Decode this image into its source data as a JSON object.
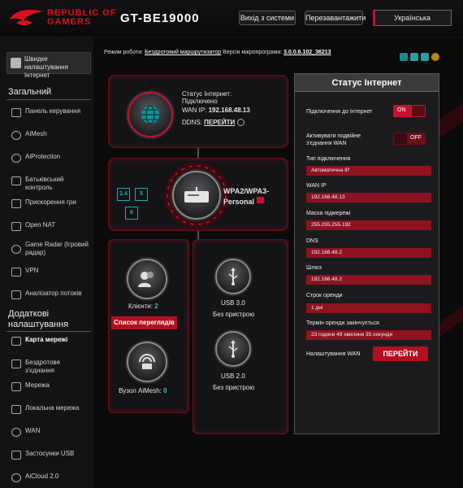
{
  "header": {
    "brand_line1": "REPUBLIC OF",
    "brand_line2": "GAMERS",
    "model": "GT-BE19000",
    "logout_label": "Вихід з системи",
    "reboot_label": "Перезавантажити",
    "language": "Українська"
  },
  "sidebar": {
    "quick_setup": "Швидке налаштування Інтернет",
    "general_title": "Загальний",
    "general_items": [
      {
        "label": "Панель керування",
        "icon": "dashboard-icon"
      },
      {
        "label": "AiMesh",
        "icon": "aimesh-icon"
      },
      {
        "label": "AiProtection",
        "icon": "shield-icon"
      },
      {
        "label": "Батьківський контроль",
        "icon": "parental-icon"
      },
      {
        "label": "Прискорення гри",
        "icon": "game-boost-icon"
      },
      {
        "label": "Open NAT",
        "icon": "nat-icon"
      },
      {
        "label": "Game Radar (Ігровий радар)",
        "icon": "radar-icon"
      },
      {
        "label": "VPN",
        "icon": "vpn-icon"
      },
      {
        "label": "Аналізатор потоків",
        "icon": "traffic-icon"
      }
    ],
    "advanced_title": "Додаткові налаштування",
    "advanced_items": [
      {
        "label": "Карта мережі",
        "icon": "network-map-icon"
      },
      {
        "label": "Бездротове з'єднання",
        "icon": "wifi-icon"
      },
      {
        "label": "Мережа",
        "icon": "network-icon"
      },
      {
        "label": "Локальна мережа",
        "icon": "lan-icon"
      },
      {
        "label": "WAN",
        "icon": "wan-icon"
      },
      {
        "label": "Застосунки USB",
        "icon": "usb-apps-icon"
      },
      {
        "label": "AiCloud 2.0",
        "icon": "cloud-icon"
      }
    ]
  },
  "topinfo": {
    "mode_label": "Режим роботи:",
    "mode_value": "Бездротовий маршрутизатор",
    "fw_label": "Версія мікропрограми:",
    "fw_value": "3.0.0.6.102_36213"
  },
  "internet": {
    "status_label": "Статус Інтернет:",
    "status_value": "Підключено",
    "wan_ip_label": "WAN IP:",
    "wan_ip_value": "192.168.48.13",
    "ddns_label": "DDNS:",
    "ddns_link": "ПЕРЕЙТИ"
  },
  "wireless": {
    "bands": [
      "2.4",
      "5",
      "6"
    ],
    "security_line1": "WPA2/WPA3-",
    "security_line2": "Personal"
  },
  "clients": {
    "label": "Клієнти:",
    "count": "2",
    "list_button": "Список переглядів",
    "aimesh_label": "Вузол AiMesh:",
    "aimesh_count": "0"
  },
  "usb": {
    "port1": "USB 3.0",
    "port1_status": "Без пристрою",
    "port2": "USB 2.0",
    "port2_status": "Без пристрою"
  },
  "status_panel": {
    "title": "Статус Інтернет",
    "connection_label": "Підключення до Інтернет",
    "connection_toggle": "ON",
    "dual_wan_label": "Активувати подвійне з'єднання WAN",
    "dual_wan_toggle": "OFF",
    "conn_type_label": "Тип підключення",
    "conn_type_value": "Автоматична IP",
    "wan_ip_label": "WAN IP",
    "wan_ip_value": "192.168.48.13",
    "mask_label": "Маска підмережі",
    "mask_value": "255.255.255.192",
    "dns_label": "DNS",
    "dns_value": "192.168.48.2",
    "gateway_label": "Шлюз",
    "gateway_value": "192.168.48.2",
    "lease_label": "Строк оренди",
    "lease_value": "1 дні",
    "lease_end_label": "Термін оренди закінчується",
    "lease_end_value": "23 години 49 хвилини 35 секунди",
    "wan_settings_label": "Налаштування WAN",
    "wan_settings_button": "ПЕРЕЙТИ"
  },
  "colors": {
    "accent": "#c8102e",
    "accent_dark": "#8e1220",
    "background": "#0a0a0b"
  }
}
